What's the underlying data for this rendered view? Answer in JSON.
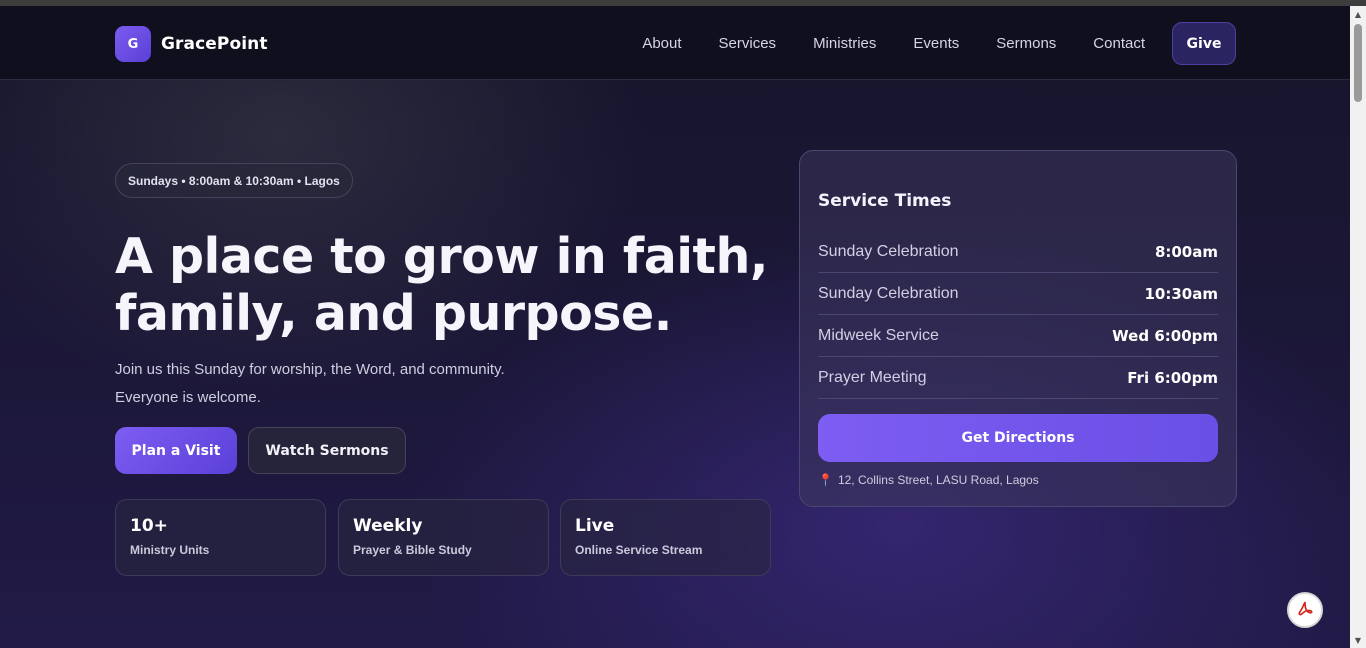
{
  "brand": {
    "logo_letter": "G",
    "name": "GracePoint"
  },
  "nav": {
    "links": [
      "About",
      "Services",
      "Ministries",
      "Events",
      "Sermons",
      "Contact"
    ],
    "give": "Give"
  },
  "hero": {
    "pill": "Sundays • 8:00am & 10:30am • Lagos",
    "title_line1": "A place to grow in faith,",
    "title_line2": "family, and purpose.",
    "sub_line1": "Join us this Sunday for worship, the Word, and community.",
    "sub_line2": "Everyone is welcome.",
    "primary_button": "Plan a Visit",
    "secondary_button": "Watch Sermons"
  },
  "stats": [
    {
      "value": "10+",
      "label": "Ministry Units"
    },
    {
      "value": "Weekly",
      "label": "Prayer & Bible Study"
    },
    {
      "value": "Live",
      "label": "Online Service Stream"
    }
  ],
  "service_times": {
    "title": "Service Times",
    "rows": [
      {
        "label": "Sunday Celebration",
        "time": "8:00am"
      },
      {
        "label": "Sunday Celebration",
        "time": "10:30am"
      },
      {
        "label": "Midweek Service",
        "time": "Wed 6:00pm"
      },
      {
        "label": "Prayer Meeting",
        "time": "Fri 6:00pm"
      }
    ],
    "directions_button": "Get Directions",
    "address": "12, Collins Street, LASU Road, Lagos"
  },
  "icons": {
    "pin": "map-pin-icon",
    "pdf": "pdf-icon"
  },
  "colors": {
    "accent": "#7d5df2",
    "background": "#1b1737",
    "pin": "#e8483c"
  }
}
